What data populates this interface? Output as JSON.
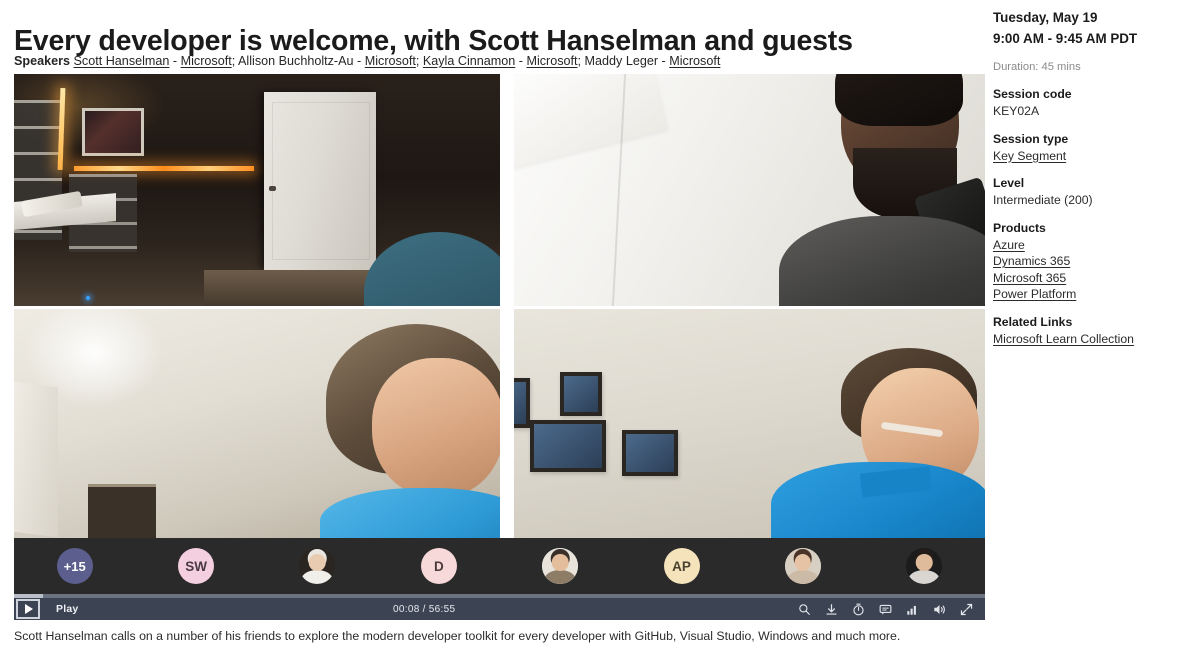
{
  "page_title": "Every developer is welcome, with Scott Hanselman and guests",
  "speakers": {
    "label": "Speakers",
    "entries": [
      {
        "name": "Scott Hanselman",
        "name_is_link": true,
        "sep": " - ",
        "org": "Microsoft",
        "org_is_link": true,
        "trail": "; "
      },
      {
        "name": "Allison Buchholtz-Au",
        "name_is_link": false,
        "sep": " - ",
        "org": "Microsoft",
        "org_is_link": true,
        "trail": "; "
      },
      {
        "name": "Kayla Cinnamon",
        "name_is_link": true,
        "sep": " - ",
        "org": "Microsoft",
        "org_is_link": true,
        "trail": "; "
      },
      {
        "name": "Maddy Leger",
        "name_is_link": false,
        "sep": " - ",
        "org": "Microsoft",
        "org_is_link": true,
        "trail": ""
      }
    ],
    "full_text": "Speakers Scott Hanselman - Microsoft; Allison Buchholtz-Au - Microsoft; Kayla Cinnamon - Microsoft; Maddy Leger - Microsoft"
  },
  "player": {
    "play_label": "Play",
    "play_icon": "play-triangle-icon",
    "current_time": "00:08",
    "total_time": "56:55",
    "time_display": "00:08 / 56:55",
    "progress_percent": 3,
    "state": "paused",
    "control_icons": [
      {
        "name": "search-icon",
        "title": "Search"
      },
      {
        "name": "download-icon",
        "title": "Download"
      },
      {
        "name": "playback-speed-icon",
        "title": "Playback speed"
      },
      {
        "name": "closed-captions-icon",
        "title": "Captions"
      },
      {
        "name": "quality-bars-icon",
        "title": "Quality"
      },
      {
        "name": "volume-icon",
        "title": "Volume"
      },
      {
        "name": "fullscreen-icon",
        "title": "Fullscreen"
      }
    ],
    "tiles": [
      {
        "id": "tile-top-left",
        "desc": "dark home office with white door and warm LED light strips"
      },
      {
        "id": "tile-top-right",
        "desc": "bearded man in dark hoodie against bright white wall"
      },
      {
        "id": "tile-bottom-left",
        "desc": "long haired man in light blue t-shirt, pale wall"
      },
      {
        "id": "tile-bottom-right",
        "desc": "man in blue polo with headset, framed photos on wall"
      }
    ],
    "participants": [
      {
        "type": "initials",
        "label": "+15",
        "bg": "#5c5f8e",
        "fg": "#ffffff"
      },
      {
        "type": "initials",
        "label": "SW",
        "bg": "#f4cfe0",
        "fg": "#4a3a43"
      },
      {
        "type": "photo",
        "label": "",
        "bg": "#2b2521",
        "skin": "#e8cbb0",
        "hair": "#e9e6e1",
        "body": "#f1efea"
      },
      {
        "type": "initials",
        "label": "D",
        "bg": "#f8d9da",
        "fg": "#4a3a3a"
      },
      {
        "type": "photo",
        "label": "",
        "bg": "#e8e4dc",
        "skin": "#e3bd9c",
        "hair": "#3a3029",
        "body": "#8d7c66"
      },
      {
        "type": "initials",
        "label": "AP",
        "bg": "#f4e3bb",
        "fg": "#4a4130"
      },
      {
        "type": "photo",
        "label": "",
        "bg": "#d8cfc3",
        "skin": "#e6c3a4",
        "hair": "#4a3328",
        "body": "#cbbba6"
      },
      {
        "type": "photo",
        "label": "",
        "bg": "#1c1c1c",
        "skin": "#e0bb9b",
        "hair": "#241c18",
        "body": "#d9d6d2"
      }
    ]
  },
  "description": "Scott Hanselman calls on a number of his friends to explore the modern developer toolkit for every developer with GitHub, Visual Studio, Windows and much more.",
  "sidebar": {
    "date": "Tuesday, May 19",
    "time_range": "9:00 AM - 9:45 AM PDT",
    "duration": "Duration: 45 mins",
    "session_code_label": "Session code",
    "session_code": "KEY02A",
    "session_type_label": "Session type",
    "session_type": "Key Segment",
    "level_label": "Level",
    "level": "Intermediate (200)",
    "products_label": "Products",
    "products": [
      "Azure",
      "Dynamics 365",
      "Microsoft 365",
      "Power Platform"
    ],
    "related_links_label": "Related Links",
    "related_links": [
      "Microsoft Learn Collection"
    ]
  },
  "colors": {
    "control_bar_bg": "#3c4454",
    "progress_track": "#6b7280",
    "progress_fill": "#b9bec7",
    "avatar_strip_bg": "#2a2a2a",
    "text_primary": "#1b1b1b",
    "text_muted": "#8a8a8a"
  }
}
